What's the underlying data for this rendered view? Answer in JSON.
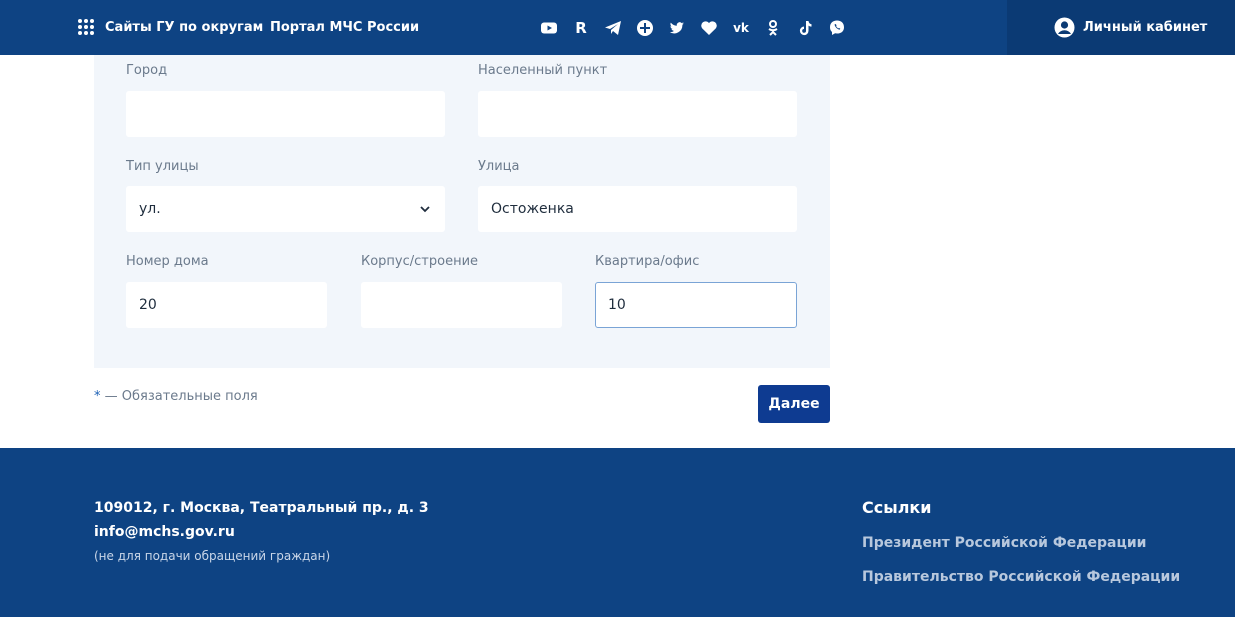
{
  "header": {
    "sites_link": "Сайты ГУ по округам",
    "portal_link": "Портал МЧС России",
    "socials": [
      {
        "name": "youtube-icon"
      },
      {
        "name": "rutube-icon",
        "glyph": "R"
      },
      {
        "name": "telegram-icon"
      },
      {
        "name": "plus-icon"
      },
      {
        "name": "twitter-icon"
      },
      {
        "name": "heart-icon"
      },
      {
        "name": "vk-icon",
        "glyph": "vk"
      },
      {
        "name": "odnoklassniki-icon"
      },
      {
        "name": "tiktok-icon",
        "glyph": "♪"
      },
      {
        "name": "viber-icon"
      }
    ],
    "account_label": "Личный кабинет"
  },
  "form": {
    "city": {
      "label": "Город",
      "value": ""
    },
    "locality": {
      "label": "Населенный пункт",
      "value": ""
    },
    "street_type": {
      "label": "Тип улицы",
      "value": "ул."
    },
    "street": {
      "label": "Улица",
      "value": "Остоженка"
    },
    "house": {
      "label": "Номер дома",
      "value": "20"
    },
    "building": {
      "label": "Корпус/строение",
      "value": ""
    },
    "apartment": {
      "label": "Квартира/офис",
      "value": "10"
    },
    "required_star": "*",
    "required_note": " — Обязательные поля",
    "next_button": "Далее"
  },
  "footer": {
    "address": "109012, г. Москва, Театральный пр., д. 3",
    "email": "info@mchs.gov.ru",
    "email_note": "(не для подачи обращений граждан)",
    "links_title": "Ссылки",
    "links": [
      "Президент Российской Федерации",
      "Правительство Российской Федерации"
    ]
  },
  "colors": {
    "header_bg": "#0e4383",
    "account_bg": "#0b3a74",
    "form_panel_bg": "#f2f6fb",
    "button_bg": "#0e3b91",
    "focus_border": "#7aa4d6"
  }
}
